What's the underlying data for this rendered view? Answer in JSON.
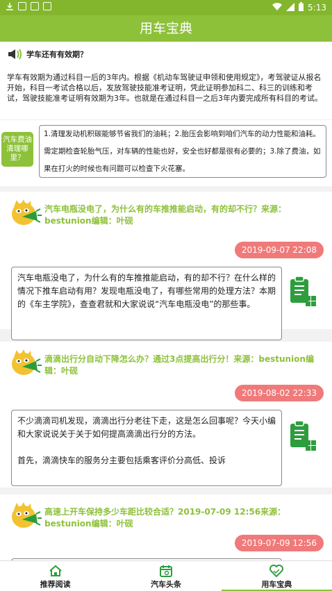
{
  "status": {
    "time": "5:13"
  },
  "appbar": {
    "title": "用车宝典"
  },
  "qa": {
    "question": "学车还有有效期？",
    "answer": "学车有效期为通过科目一后的3年内。根据《机动车驾驶证申领和使用规定》，考驾驶证从报名开始，科目一考试合格以后，发放驾驶技能准考证明，凭此证明参加科二、科三的训练和考试，驾驶技能准考证明有效期为3年。也就是在通过科目一之后3年内要完成所有科目的考试。"
  },
  "tip": {
    "tag": "汽车费油清理哪里？",
    "text": "1.清理发动机积碳能够节省我们的油耗；2.胎压会影响到咱们汽车的动力性能和油耗。需定期检查轮胎气压，对车辆的性能也好，安全也好都是很有必要的；3.除了费油，如果在打火的时候也有问题可以检查下火花塞。"
  },
  "cards": [
    {
      "title": "汽车电瓶没电了，为什么有的车推推能启动，有的却不行？来源：bestunion编辑：叶砚",
      "time": "2019-09-07 22:08",
      "text": "汽车电瓶没电了，为什么有的车推推能启动，有的却不行？在什么样的情况下推车启动有用？发现电瓶没电了，有哪些常用的处理方法？本期的《车主学院》，查查君就和大家说说“汽车电瓶没电”的那些事。"
    },
    {
      "title": "滴滴出行分自动下降怎么办？通过3点提高出行分！来源：bestunion编辑：叶砚",
      "time": "2019-08-02 22:33",
      "text": "不少滴滴司机发现，滴滴出行分老往下走，这是怎么回事呢？今天小编和大家说说关于关于如何提高滴滴出行分的方法。\n\n首先，滴滴快车的服务分主要包括乘客评价分高低、投诉"
    },
    {
      "title": "高速上开车保持多少车距比较合适？2019-07-09 12:56来源：bestunion编辑：叶砚",
      "time": "2019-07-09 12:56",
      "text": ""
    }
  ],
  "tabs": [
    {
      "label": "推荐阅读",
      "icon": "home-icon"
    },
    {
      "label": "汽车头条",
      "icon": "calendar-icon"
    },
    {
      "label": "用车宝典",
      "icon": "heart-icon"
    }
  ],
  "colors": {
    "primary": "#8dc13a",
    "statusbar": "#83b62d",
    "timebadge": "#f07a7a",
    "doc": "#2e9d3e"
  }
}
